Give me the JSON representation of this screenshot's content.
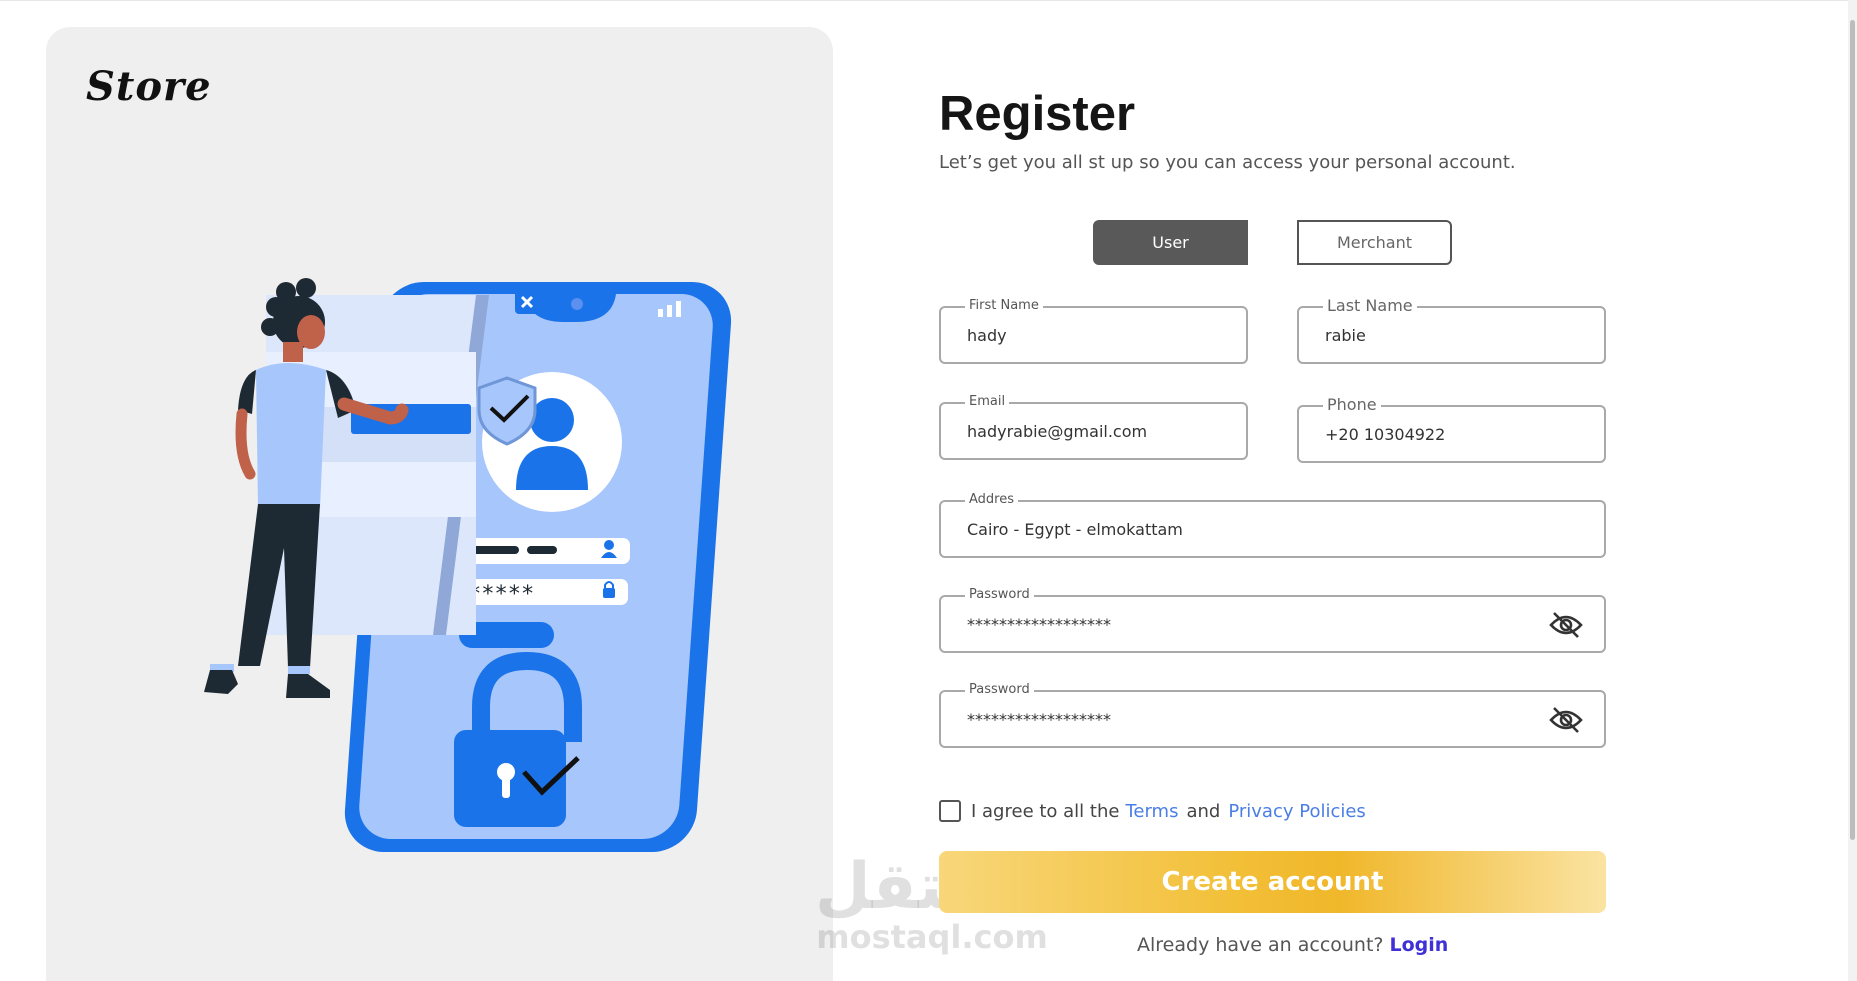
{
  "brand": {
    "name": "Store"
  },
  "header": {
    "title": "Register",
    "subtitle": "Let’s get you all st up so you can access your personal account."
  },
  "account_type": {
    "user_label": "User",
    "merchant_label": "Merchant",
    "selected": "User"
  },
  "form": {
    "first_name": {
      "label": "First Name",
      "value": "hady"
    },
    "last_name": {
      "label": "Last Name",
      "value": "rabie"
    },
    "email": {
      "label": "Email",
      "value": "hadyrabie@gmail.com"
    },
    "phone": {
      "label": "Phone",
      "value": "+20 10304922"
    },
    "address": {
      "label": "Addres",
      "value": "Cairo - Egypt - elmokattam"
    },
    "password": {
      "label": "Password",
      "value": "******************"
    },
    "confirm_password": {
      "label": "Password",
      "value": "******************"
    }
  },
  "agree": {
    "prefix": "I agree to all the",
    "terms": "Terms",
    "and": "and",
    "privacy": "Privacy Policies",
    "checked": false
  },
  "create_button": {
    "label": "Create account"
  },
  "login": {
    "prompt": "Already have an account?",
    "link": "Login"
  },
  "watermark": {
    "arabic": "مستقل",
    "latin": "mostaql.com"
  },
  "colors": {
    "primary_blue": "#1a73e8",
    "light_blue": "#a7c6fb",
    "toggle_active": "#595959",
    "button_gold": "#f0b72a",
    "link_blue": "#4a7ee6",
    "login_link": "#3f31d6"
  }
}
